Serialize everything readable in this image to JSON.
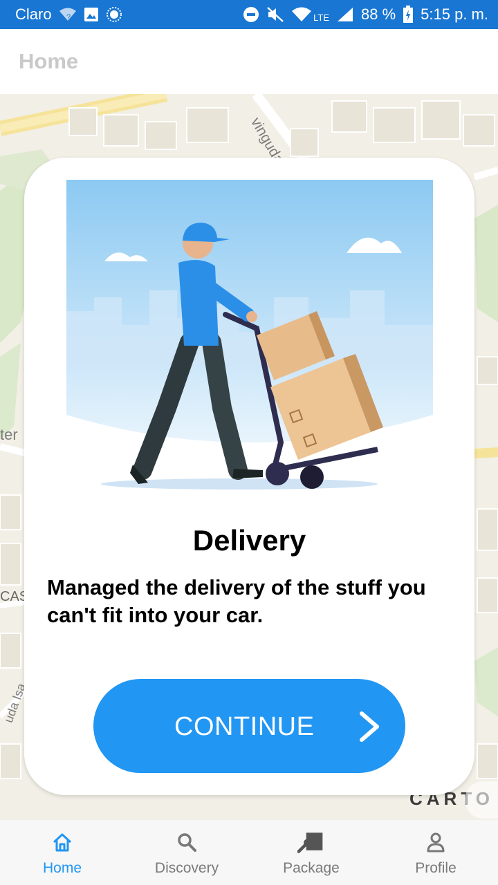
{
  "status_bar": {
    "carrier": "Claro",
    "network": "LTE",
    "battery": "88 %",
    "time": "5:15 p. m."
  },
  "app_bar": {
    "title": "Home"
  },
  "map": {
    "attribution": "CARTO",
    "labels": [
      "vinguda",
      "ter",
      "CAS",
      "uda Isa"
    ]
  },
  "card": {
    "title": "Delivery",
    "description": "Managed the delivery of the stuff you can't fit into your car.",
    "button_label": "CONTINUE"
  },
  "bottom_nav": {
    "items": [
      {
        "label": "Home",
        "icon": "home-icon",
        "active": true
      },
      {
        "label": "Discovery",
        "icon": "search-icon",
        "active": false
      },
      {
        "label": "Package",
        "icon": "package-icon",
        "active": false
      },
      {
        "label": "Profile",
        "icon": "person-icon",
        "active": false
      }
    ]
  },
  "colors": {
    "status_bar": "#1976d2",
    "accent": "#2196f3",
    "inactive": "#7a7a7a"
  }
}
